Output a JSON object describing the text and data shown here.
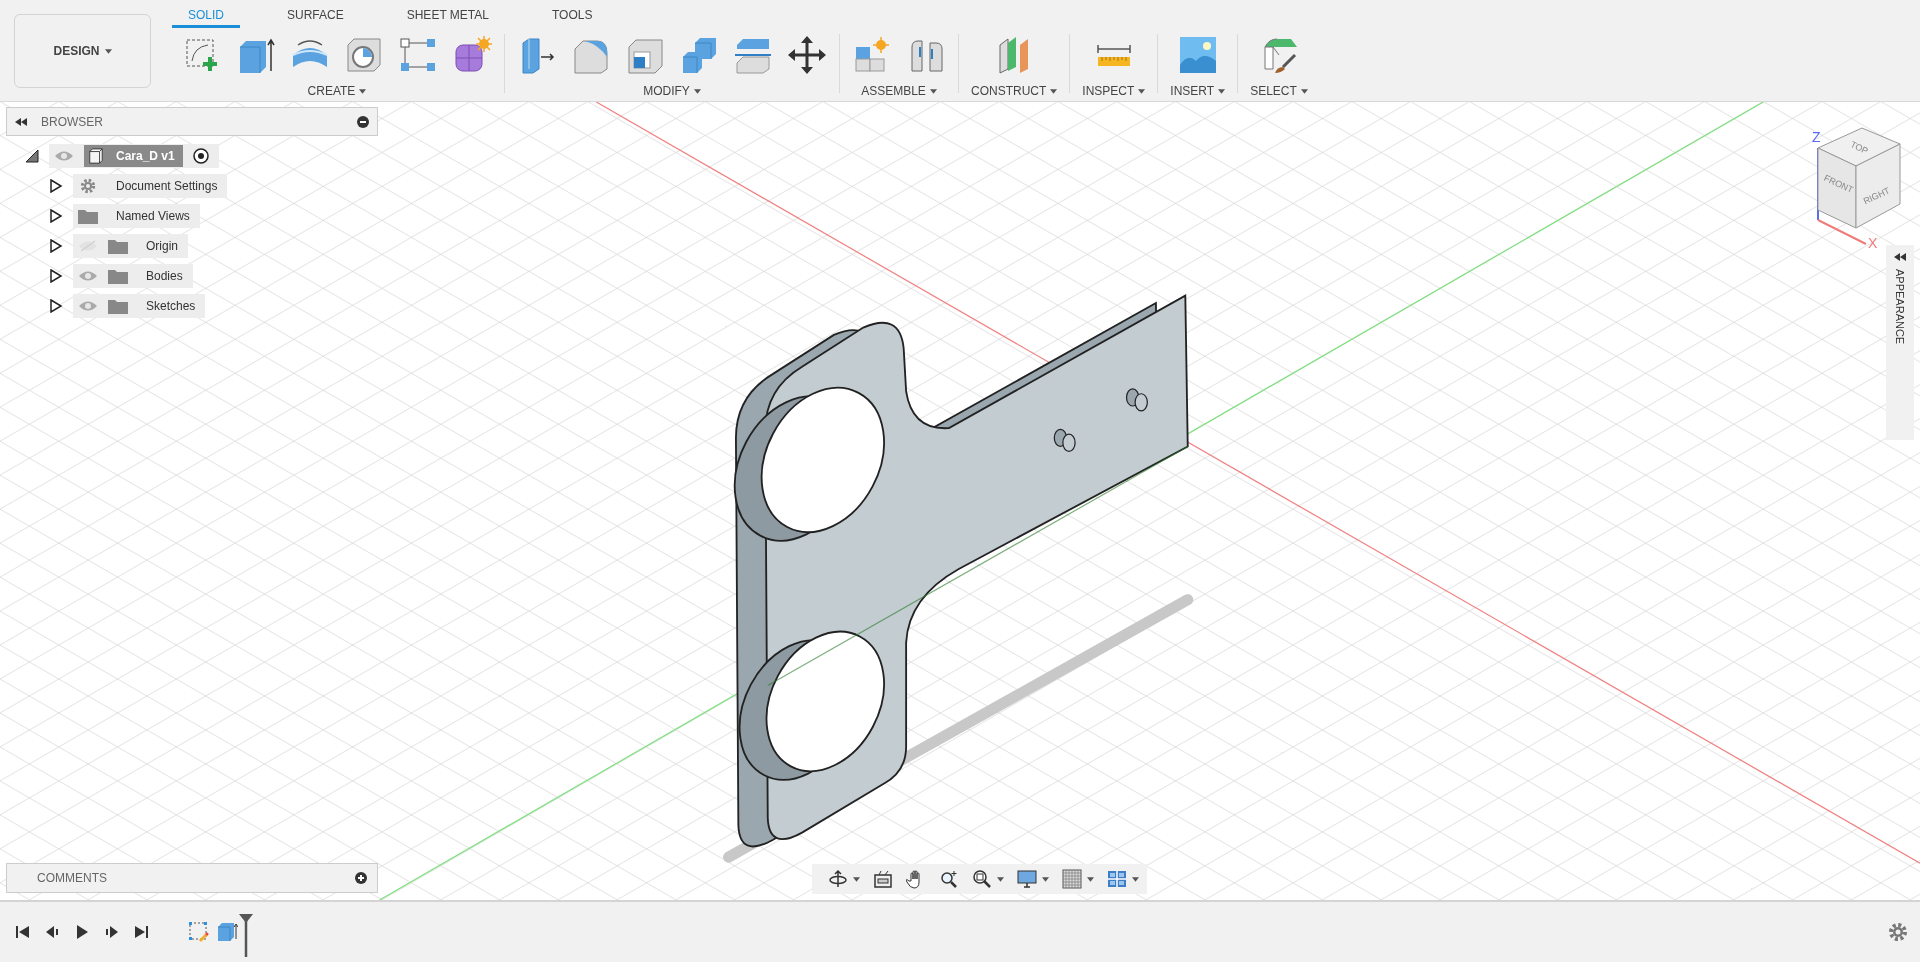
{
  "design_button": {
    "label": "DESIGN"
  },
  "tabs": [
    {
      "label": "SOLID",
      "selected": true
    },
    {
      "label": "SURFACE",
      "selected": false
    },
    {
      "label": "SHEET METAL",
      "selected": false
    },
    {
      "label": "TOOLS",
      "selected": false
    }
  ],
  "tool_groups": [
    {
      "label": "CREATE"
    },
    {
      "label": "MODIFY"
    },
    {
      "label": "ASSEMBLE"
    },
    {
      "label": "CONSTRUCT"
    },
    {
      "label": "INSPECT"
    },
    {
      "label": "INSERT"
    },
    {
      "label": "SELECT"
    }
  ],
  "browser": {
    "title": "BROWSER",
    "root": {
      "label": "Cara_D v1",
      "visible": true,
      "expanded": true,
      "children": [
        {
          "label": "Document Settings",
          "kind": "settings",
          "expanded": false
        },
        {
          "label": "Named Views",
          "kind": "folder",
          "expanded": false
        },
        {
          "label": "Origin",
          "kind": "folder",
          "visible": false,
          "expanded": false
        },
        {
          "label": "Bodies",
          "kind": "folder",
          "visible": true,
          "expanded": false
        },
        {
          "label": "Sketches",
          "kind": "folder",
          "visible": true,
          "expanded": false
        }
      ]
    }
  },
  "view_cube": {
    "top": "TOP",
    "front": "FRONT",
    "right": "RIGHT",
    "z_axis": "Z",
    "x_axis": "X"
  },
  "appearance_panel": {
    "title": "APPEARANCE"
  },
  "comments": {
    "title": "COMMENTS"
  }
}
